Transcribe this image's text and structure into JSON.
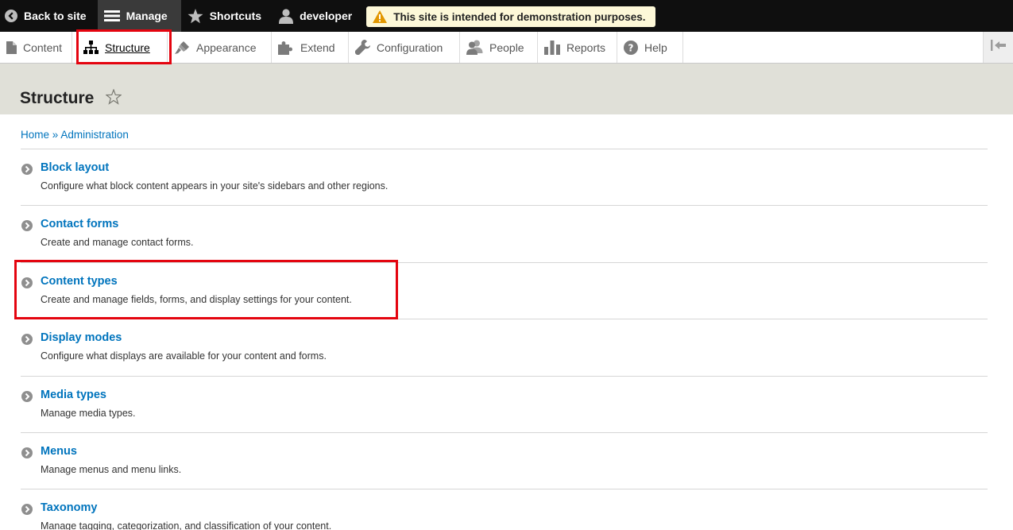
{
  "topbar": {
    "back_label": "Back to site",
    "manage_label": "Manage",
    "shortcuts_label": "Shortcuts",
    "user_label": "developer",
    "warning_text": "This site is intended for demonstration purposes."
  },
  "tray": {
    "items": [
      {
        "label": "Content",
        "icon": "file-icon"
      },
      {
        "label": "Structure",
        "icon": "sitemap-icon",
        "active": true
      },
      {
        "label": "Appearance",
        "icon": "paintbrush-icon"
      },
      {
        "label": "Extend",
        "icon": "puzzle-icon"
      },
      {
        "label": "Configuration",
        "icon": "wrench-icon"
      },
      {
        "label": "People",
        "icon": "people-icon"
      },
      {
        "label": "Reports",
        "icon": "bar-chart-icon"
      },
      {
        "label": "Help",
        "icon": "help-icon"
      }
    ]
  },
  "page": {
    "title": "Structure"
  },
  "breadcrumb": {
    "home": "Home",
    "separator": "»",
    "admin": "Administration"
  },
  "admin_list": [
    {
      "title": "Block layout",
      "description": "Configure what block content appears in your site's sidebars and other regions."
    },
    {
      "title": "Contact forms",
      "description": "Create and manage contact forms."
    },
    {
      "title": "Content types",
      "description": "Create and manage fields, forms, and display settings for your content."
    },
    {
      "title": "Display modes",
      "description": "Configure what displays are available for your content and forms."
    },
    {
      "title": "Media types",
      "description": "Manage media types."
    },
    {
      "title": "Menus",
      "description": "Manage menus and menu links."
    },
    {
      "title": "Taxonomy",
      "description": "Manage tagging, categorization, and classification of your content."
    }
  ],
  "colors": {
    "link": "#0074bd",
    "toolbar_bg": "#0f0f0f",
    "header_band": "#e0e0d8",
    "highlight": "#e4040f",
    "warning_bg": "#fdf8d8"
  }
}
